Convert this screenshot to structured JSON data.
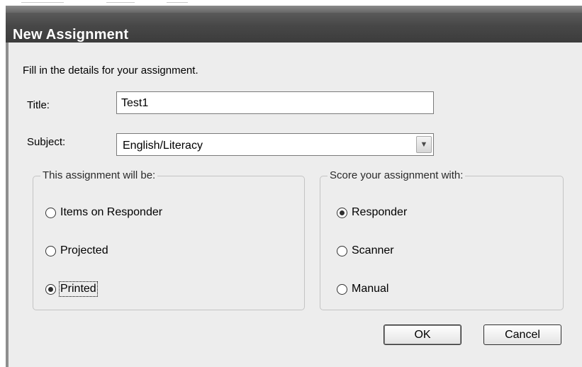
{
  "window": {
    "title": "New Assignment"
  },
  "instructions": "Fill in the details for your assignment.",
  "form": {
    "title_label": "Title:",
    "title_value": "Test1",
    "subject_label": "Subject:",
    "subject_value": "English/Literacy"
  },
  "assignment_type": {
    "legend": "This assignment will be:",
    "options": [
      {
        "label": "Items on Responder",
        "selected": false
      },
      {
        "label": "Projected",
        "selected": false
      },
      {
        "label": "Printed",
        "selected": true
      }
    ]
  },
  "scoring": {
    "legend": "Score your assignment with:",
    "options": [
      {
        "label": "Responder",
        "selected": true
      },
      {
        "label": "Scanner",
        "selected": false
      },
      {
        "label": "Manual",
        "selected": false
      }
    ]
  },
  "buttons": {
    "ok": "OK",
    "cancel": "Cancel"
  },
  "icons": {
    "dropdown": "chevron-down-icon"
  }
}
